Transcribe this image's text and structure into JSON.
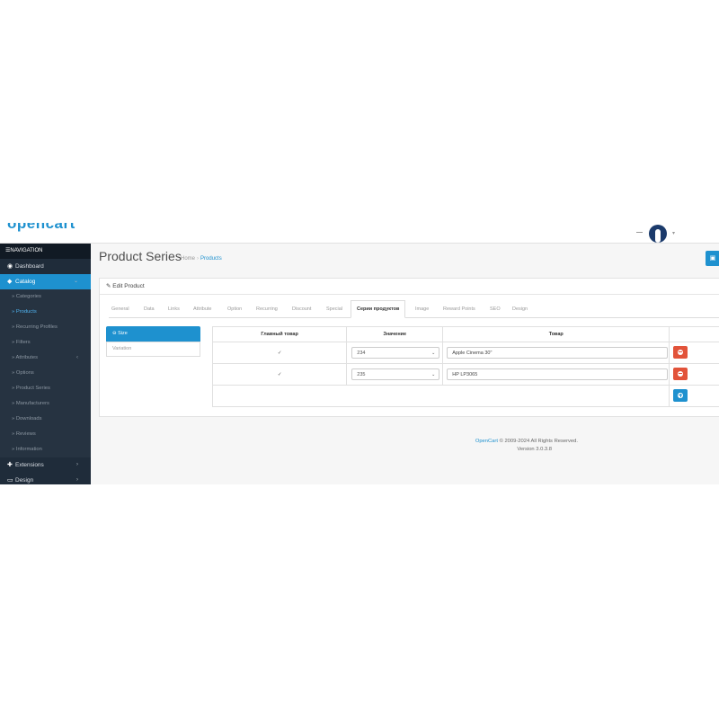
{
  "header": {
    "logo": "opencart",
    "user_caret": "▾"
  },
  "sidebar": {
    "nav_label": "NAVIGATION",
    "items": [
      {
        "label": "Dashboard"
      },
      {
        "label": "Catalog"
      },
      {
        "label": "Categories"
      },
      {
        "label": "Products"
      },
      {
        "label": "Recurring Profiles"
      },
      {
        "label": "Filters"
      },
      {
        "label": "Attributes"
      },
      {
        "label": "Options"
      },
      {
        "label": "Product Series"
      },
      {
        "label": "Manufacturers"
      },
      {
        "label": "Downloads"
      },
      {
        "label": "Reviews"
      },
      {
        "label": "Information"
      },
      {
        "label": "Extensions"
      },
      {
        "label": "Design"
      }
    ]
  },
  "page": {
    "title": "Product Series",
    "breadcrumb": [
      "Home",
      "Products"
    ],
    "panel_title": "Edit Product"
  },
  "tabs": [
    "General",
    "Data",
    "Links",
    "Attribute",
    "Option",
    "Recurring",
    "Discount",
    "Special",
    "Серии продуктов",
    "Image",
    "Reward Points",
    "SEO",
    "Design"
  ],
  "variants": [
    "Size",
    "Variation"
  ],
  "table": {
    "headers": [
      "Главный товар",
      "Значение",
      "Товар"
    ],
    "rows": [
      {
        "checked": "✓",
        "value": "234",
        "product": "Apple Cinema 30\""
      },
      {
        "checked": "✓",
        "value": "235",
        "product": "HP LP3065"
      }
    ]
  },
  "footer": {
    "brand": "OpenCart",
    "copyright": "© 2009-2024 All Rights Reserved.",
    "version": "Version 3.0.3.8"
  },
  "colors": {
    "accent": "#1e91cf",
    "danger": "#e2533a",
    "sidebar": "#1f2c3a"
  }
}
